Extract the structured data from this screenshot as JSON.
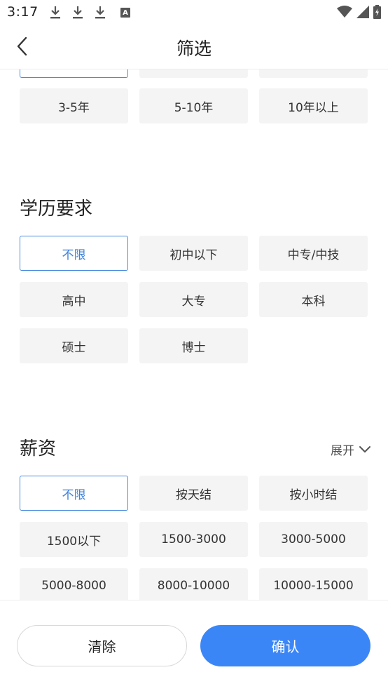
{
  "status_bar": {
    "time": "3:17",
    "left_icons": [
      "download-icon",
      "download-icon",
      "download-icon",
      "a-badge-icon"
    ],
    "right_icons": [
      "wifi-icon",
      "signal-icon",
      "battery-charging-icon"
    ],
    "a_badge": "A"
  },
  "nav": {
    "title": "筛选",
    "back_icon": "chevron-left-icon"
  },
  "experience": {
    "options": [
      "3-5年",
      "5-10年",
      "10年以上"
    ]
  },
  "education": {
    "title": "学历要求",
    "options": [
      "不限",
      "初中以下",
      "中专/中技",
      "高中",
      "大专",
      "本科",
      "硕士",
      "博士"
    ],
    "selected": "不限"
  },
  "salary": {
    "title": "薪资",
    "expand_label": "展开",
    "options": [
      "不限",
      "按天结",
      "按小时结",
      "1500以下",
      "1500-3000",
      "3000-5000",
      "5000-8000",
      "8000-10000",
      "10000-15000"
    ],
    "selected": "不限"
  },
  "actions": {
    "clear_label": "清除",
    "confirm_label": "确认"
  },
  "colors": {
    "accent": "#3b86f7",
    "selected_border": "#4a8bde",
    "chip_bg": "#f4f4f4"
  }
}
